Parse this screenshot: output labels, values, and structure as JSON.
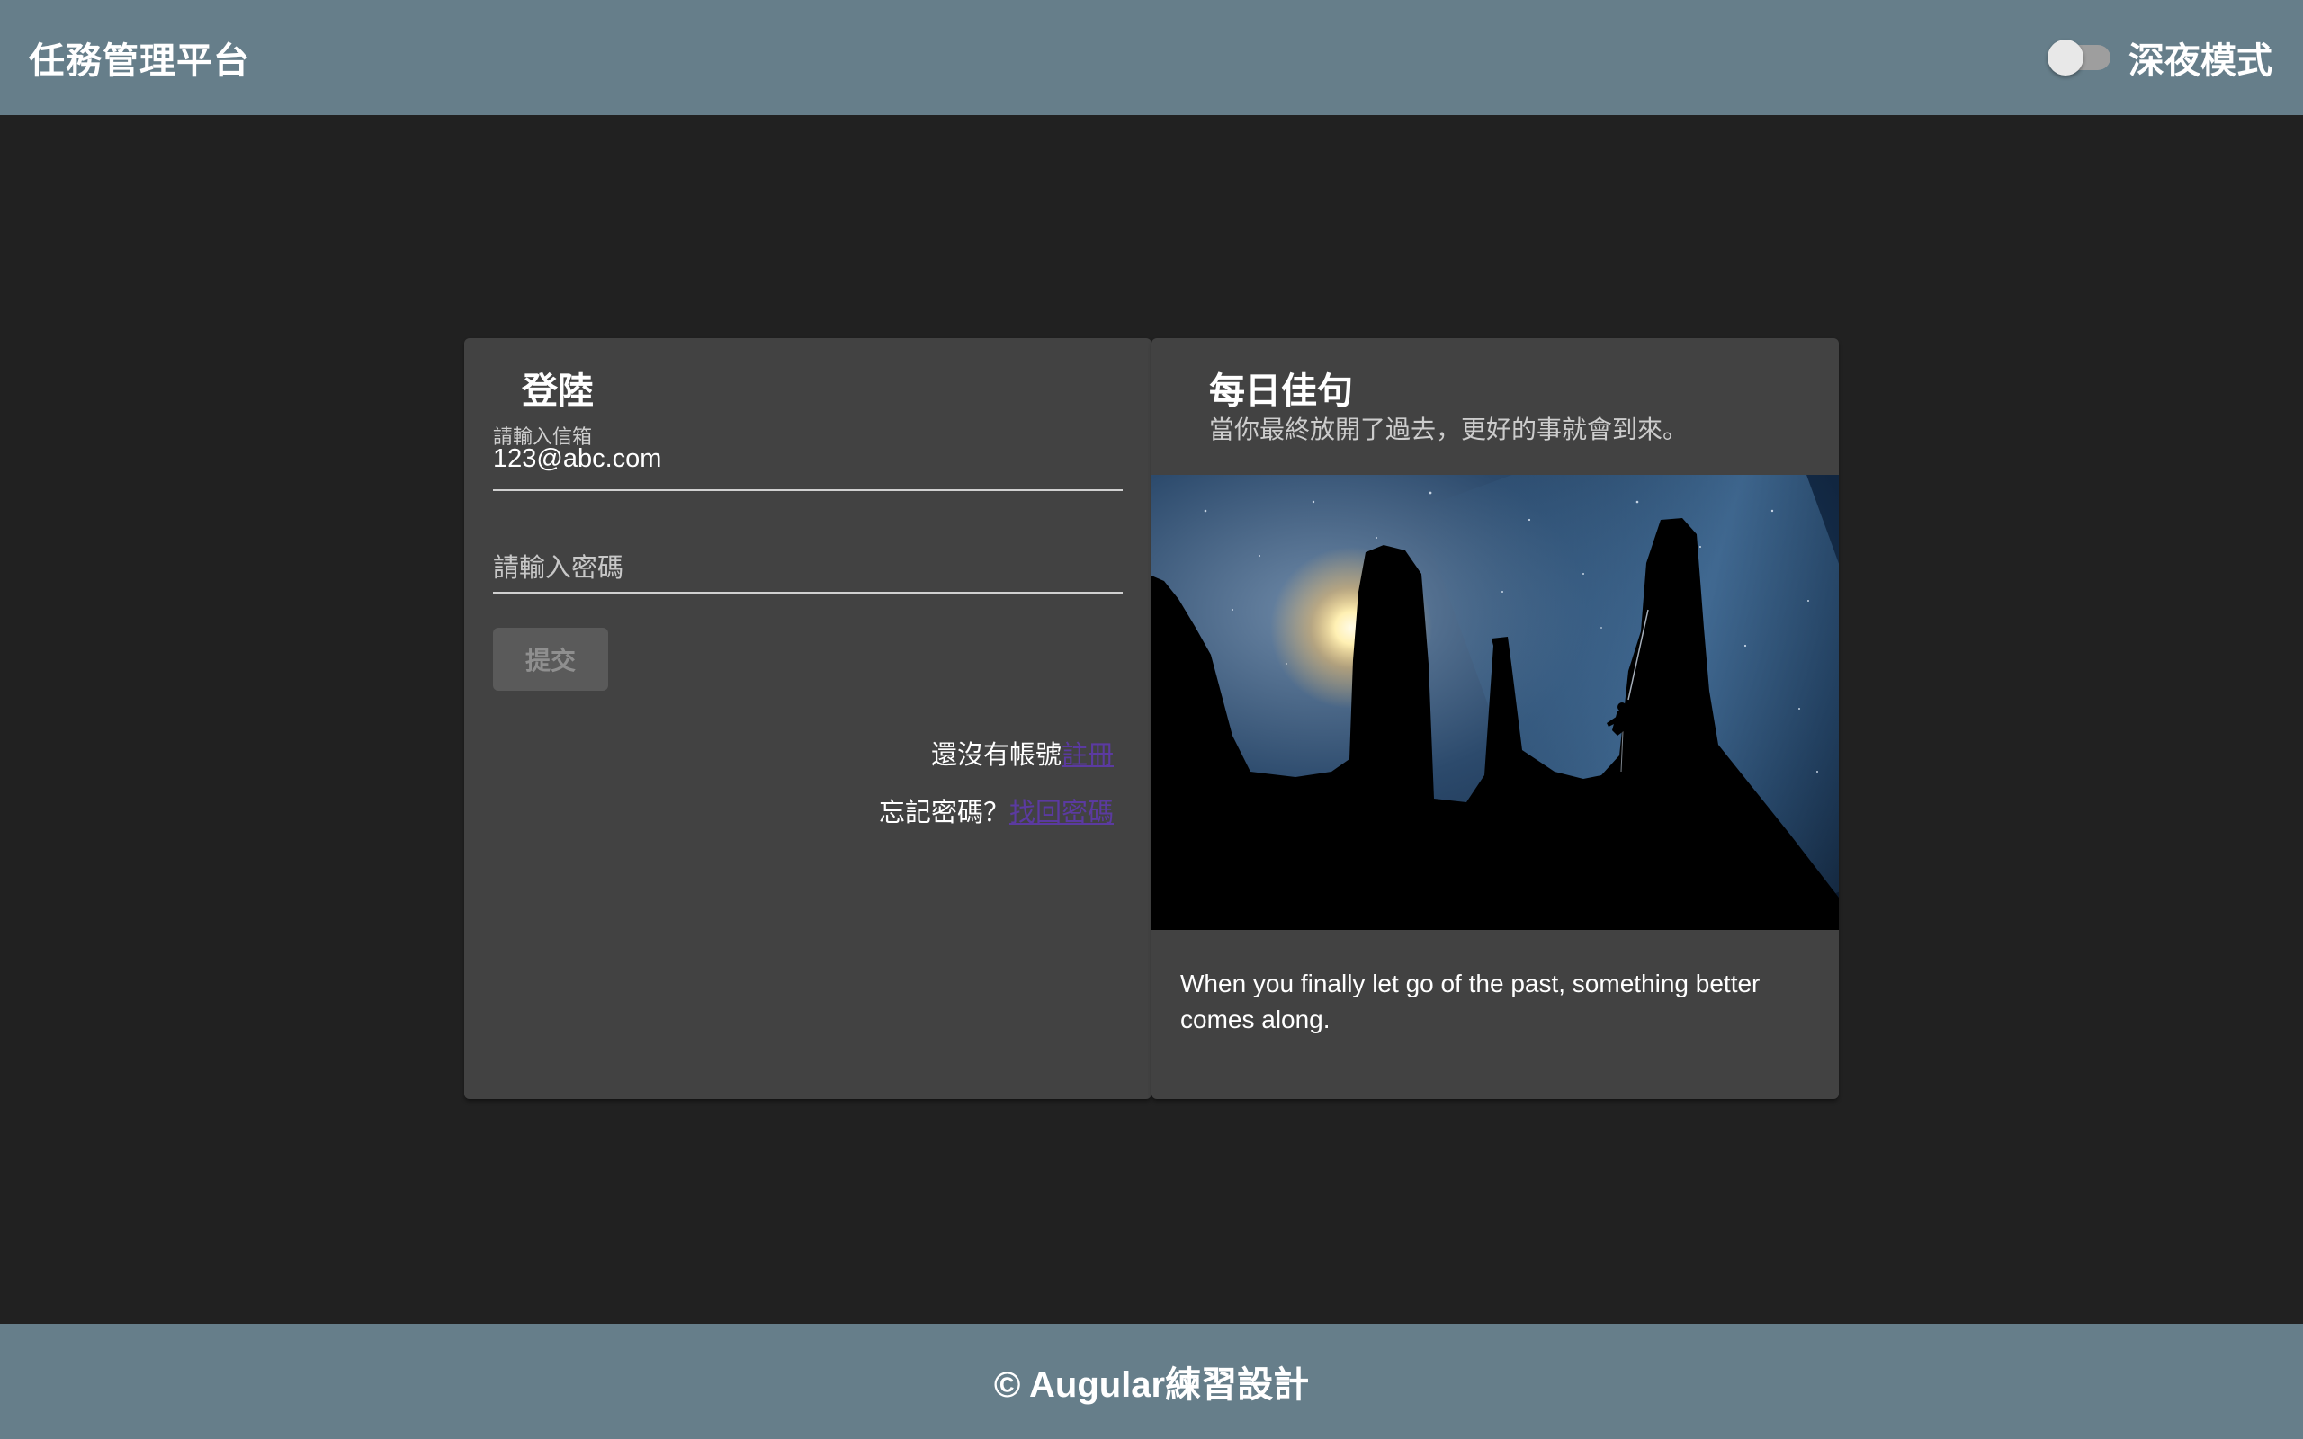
{
  "toolbar": {
    "title": "任務管理平台",
    "night_mode_label": "深夜模式",
    "night_mode_on": false
  },
  "login": {
    "title": "登陸",
    "email_label": "請輸入信箱",
    "email_value": "123@abc.com",
    "password_placeholder": "請輸入密碼",
    "submit_label": "提交",
    "no_account_text": "還沒有帳號",
    "register_link": "註冊",
    "forgot_text": "忘記密碼？",
    "recover_link": "找回密碼"
  },
  "quote": {
    "title": "每日佳句",
    "chinese": "當你最終放開了過去，更好的事就會到來。",
    "english": "When you finally let go of the past, something better comes along."
  },
  "footer": {
    "text": "© Augular練習設計"
  },
  "colors": {
    "toolbar_bg": "#667e8a",
    "page_bg": "#212121",
    "card_bg": "#424242",
    "link": "#5b3aa0"
  }
}
